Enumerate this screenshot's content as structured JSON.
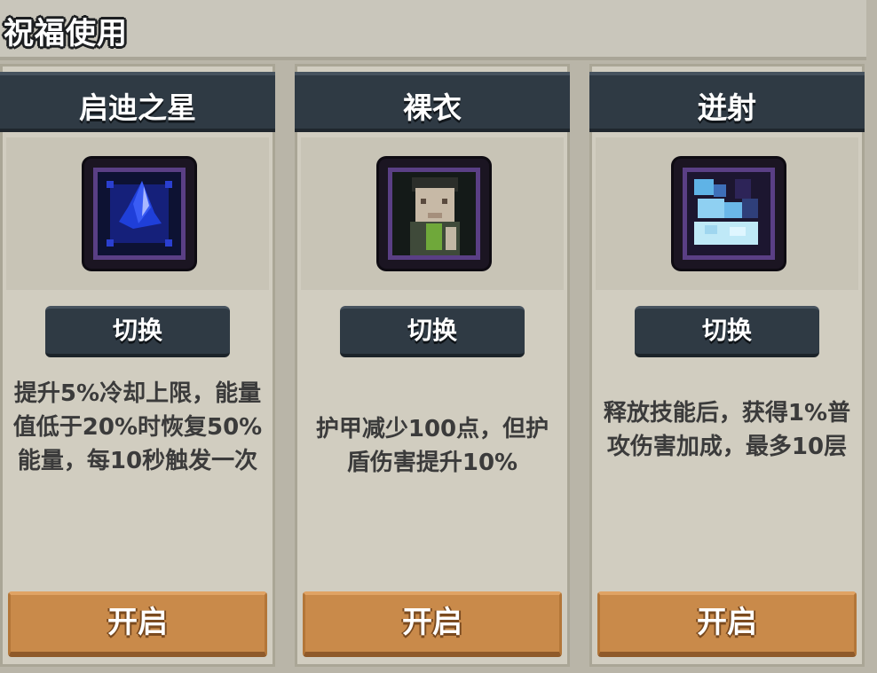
{
  "header": {
    "title": "祝福使用"
  },
  "cards": [
    {
      "name": "启迪之星",
      "icon": "blue-crystal-star-icon",
      "switch_label": "切换",
      "description": "提升5%冷却上限，能量值低于20%时恢复50%能量，每10秒触发一次",
      "open_label": "开启"
    },
    {
      "name": "裸衣",
      "icon": "bare-robe-portrait-icon",
      "switch_label": "切换",
      "description": "护甲减少100点，但护盾伤害提升10%",
      "open_label": "开启"
    },
    {
      "name": "迸射",
      "icon": "ice-burst-icon",
      "switch_label": "切换",
      "description": "释放技能后，获得1%普攻伤害加成，最多10层",
      "open_label": "开启"
    }
  ],
  "colors": {
    "panel": "#d1cdc0",
    "title_bar": "#2f3a44",
    "open_button": "#c98a4a",
    "icon_frame": "#5a3f85"
  }
}
